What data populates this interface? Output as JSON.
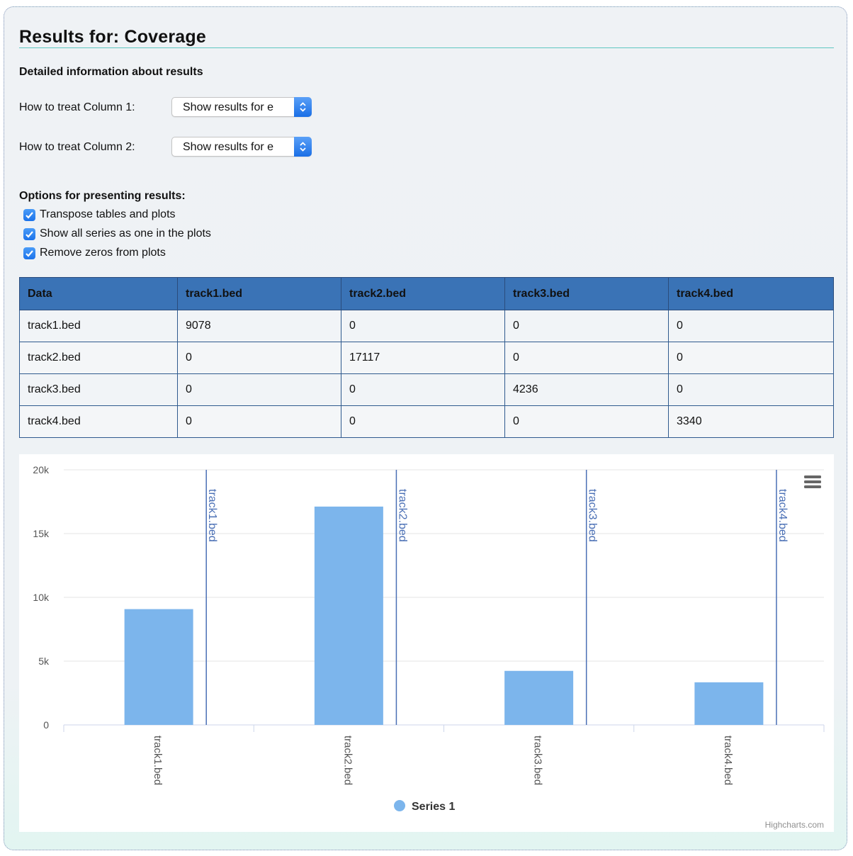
{
  "header": {
    "title": "Results for: Coverage",
    "subtitle": "Detailed information about results"
  },
  "controls": {
    "column1_label": "How to treat Column 1:",
    "column1_value": "Show results for e",
    "column2_label": "How to treat Column 2:",
    "column2_value": "Show results for e"
  },
  "options": {
    "heading": "Options for presenting results:",
    "items": [
      {
        "label": "Transpose tables and plots",
        "checked": true
      },
      {
        "label": "Show all series as one in the plots",
        "checked": true
      },
      {
        "label": "Remove zeros from plots",
        "checked": true
      }
    ]
  },
  "table": {
    "headers": [
      "Data",
      "track1.bed",
      "track2.bed",
      "track3.bed",
      "track4.bed"
    ],
    "rows": [
      [
        "track1.bed",
        "9078",
        "0",
        "0",
        "0"
      ],
      [
        "track2.bed",
        "0",
        "17117",
        "0",
        "0"
      ],
      [
        "track3.bed",
        "0",
        "0",
        "4236",
        "0"
      ],
      [
        "track4.bed",
        "0",
        "0",
        "0",
        "3340"
      ]
    ]
  },
  "colors": {
    "header_bg": "#3a73b6",
    "bar": "#7cb5ec",
    "plot_line": "#4a6fb5"
  },
  "chart_menu_icon": "hamburger-menu-icon",
  "chart_credit": "Highcharts.com",
  "chart_data": {
    "type": "bar",
    "categories": [
      "track1.bed",
      "track2.bed",
      "track3.bed",
      "track4.bed"
    ],
    "series": [
      {
        "name": "Series 1",
        "values": [
          9078,
          17117,
          4236,
          3340
        ]
      }
    ],
    "plot_lines": [
      "track1.bed",
      "track2.bed",
      "track3.bed",
      "track4.bed"
    ],
    "y_ticks": [
      "0",
      "5k",
      "10k",
      "15k",
      "20k"
    ],
    "ylim": [
      0,
      20000
    ],
    "grid": true,
    "legend": "bottom-center"
  }
}
